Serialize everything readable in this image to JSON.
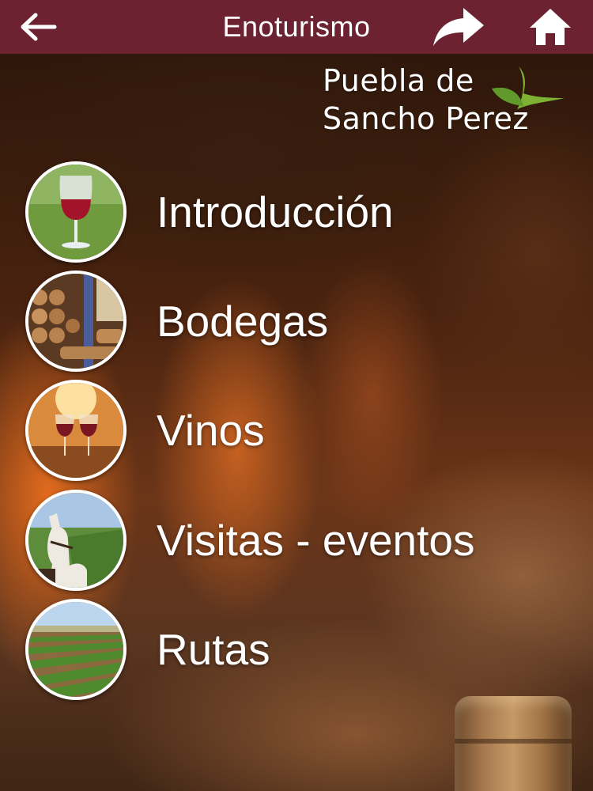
{
  "app_bar": {
    "title": "Enoturismo",
    "back_icon": "arrow-left-icon",
    "share_icon": "share-icon",
    "home_icon": "home-icon",
    "background_color": "#6c2230"
  },
  "brand": {
    "line1": "Puebla de",
    "line2": "Sancho Perez",
    "accent_color": "#7db232"
  },
  "menu": {
    "items": [
      {
        "label": "Introducción",
        "image": "red-wine-glass-image"
      },
      {
        "label": "Bodegas",
        "image": "wine-barrels-cellar-image"
      },
      {
        "label": "Vinos",
        "image": "wine-glasses-toast-image"
      },
      {
        "label": "Visitas - eventos",
        "image": "horse-carriage-vineyard-image"
      },
      {
        "label": "Rutas",
        "image": "vineyard-rows-image"
      }
    ]
  }
}
